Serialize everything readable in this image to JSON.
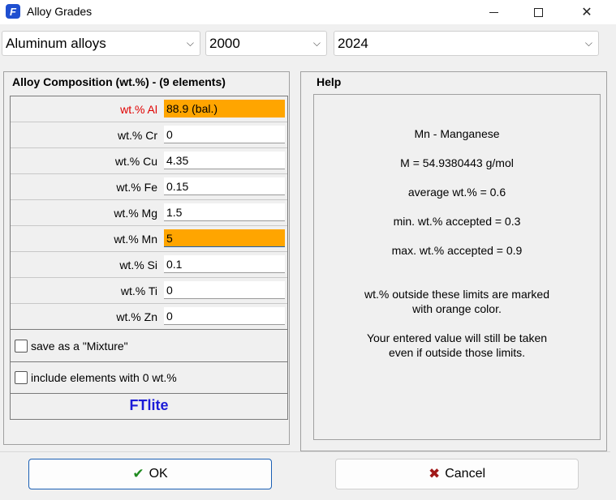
{
  "window": {
    "title": "Alloy Grades",
    "app_icon_letter": "F"
  },
  "selectors": {
    "alloy_type": "Aluminum alloys",
    "series": "2000",
    "grade": "2024"
  },
  "composition": {
    "title": "Alloy Composition (wt.%) - (9 elements)",
    "rows": [
      {
        "label": "wt.% Al",
        "value": "88.9 (bal.)"
      },
      {
        "label": "wt.% Cr",
        "value": "0"
      },
      {
        "label": "wt.% Cu",
        "value": "4.35"
      },
      {
        "label": "wt.% Fe",
        "value": "0.15"
      },
      {
        "label": "wt.% Mg",
        "value": "1.5"
      },
      {
        "label": "wt.% Mn",
        "value": "5"
      },
      {
        "label": "wt.% Si",
        "value": "0.1"
      },
      {
        "label": "wt.% Ti",
        "value": "0"
      },
      {
        "label": "wt.% Zn",
        "value": "0"
      }
    ],
    "save_mixture_label": "save as a \"Mixture\"",
    "include_zero_label": "include elements with 0 wt.%",
    "brand": "FTlite"
  },
  "help": {
    "title": "Help",
    "element": "Mn - Manganese",
    "molar_mass": "M = 54.9380443 g/mol",
    "average": "average wt.% = 0.6",
    "min": "min. wt.% accepted = 0.3",
    "max": "max. wt.% accepted = 0.9",
    "note1_line1": "wt.% outside these limits are marked",
    "note1_line2": "with orange color.",
    "note2_line1": "Your entered value will still be taken",
    "note2_line2": "even if outside those limits."
  },
  "buttons": {
    "ok": "OK",
    "cancel": "Cancel"
  },
  "colors": {
    "out_of_range": "#ffa500",
    "balance_label": "#e00000",
    "brand": "#1c1cd8"
  }
}
